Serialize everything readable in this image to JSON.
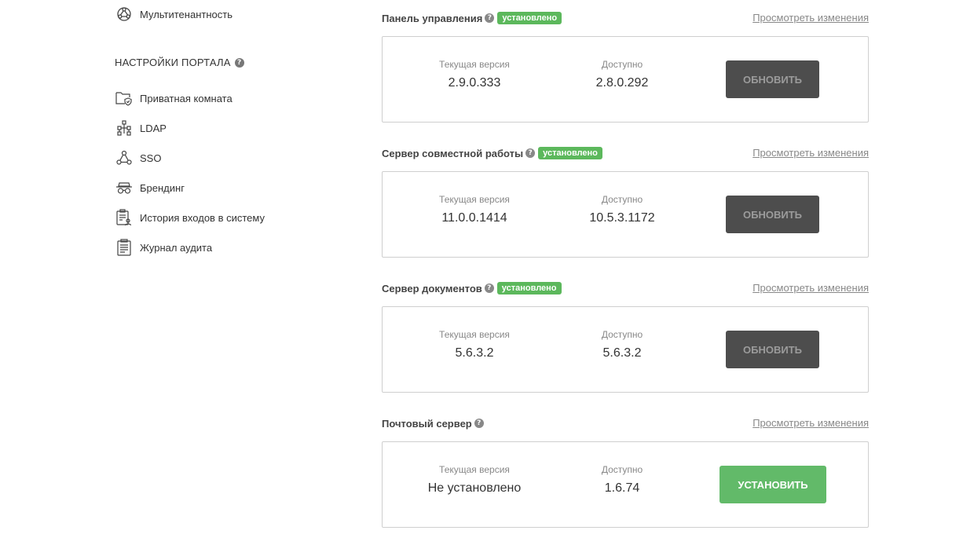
{
  "sidebar": {
    "top_item": {
      "label": "Мультитенантность",
      "icon": "globe-icon"
    },
    "section_title": "НАСТРОЙКИ ПОРТАЛА",
    "items": [
      {
        "label": "Приватная комната",
        "icon": "folder-shield-icon"
      },
      {
        "label": "LDAP",
        "icon": "ldap-tree-icon"
      },
      {
        "label": "SSO",
        "icon": "sso-nodes-icon"
      },
      {
        "label": "Брендинг",
        "icon": "mask-icon"
      },
      {
        "label": "История входов в систему",
        "icon": "login-history-icon"
      },
      {
        "label": "Журнал аудита",
        "icon": "audit-log-icon"
      }
    ]
  },
  "labels": {
    "current_version": "Текущая версия",
    "available": "Доступно",
    "view_changes": "Просмотреть изменения",
    "installed_badge": "установлено",
    "update_button": "ОБНОВИТЬ",
    "install_button": "УСТАНОВИТЬ"
  },
  "modules": [
    {
      "title": "Панель управления",
      "installed": true,
      "current": "2.9.0.333",
      "available": "2.8.0.292"
    },
    {
      "title": "Сервер совместной работы",
      "installed": true,
      "current": "11.0.0.1414",
      "available": "10.5.3.1172"
    },
    {
      "title": "Сервер документов",
      "installed": true,
      "current": "5.6.3.2",
      "available": "5.6.3.2"
    },
    {
      "title": "Почтовый сервер",
      "installed": false,
      "current": "Не установлено",
      "available": "1.6.74"
    }
  ],
  "colors": {
    "badge_green": "#5cb85c",
    "install_green": "#62ba69",
    "update_dark": "#4d4d4d"
  }
}
